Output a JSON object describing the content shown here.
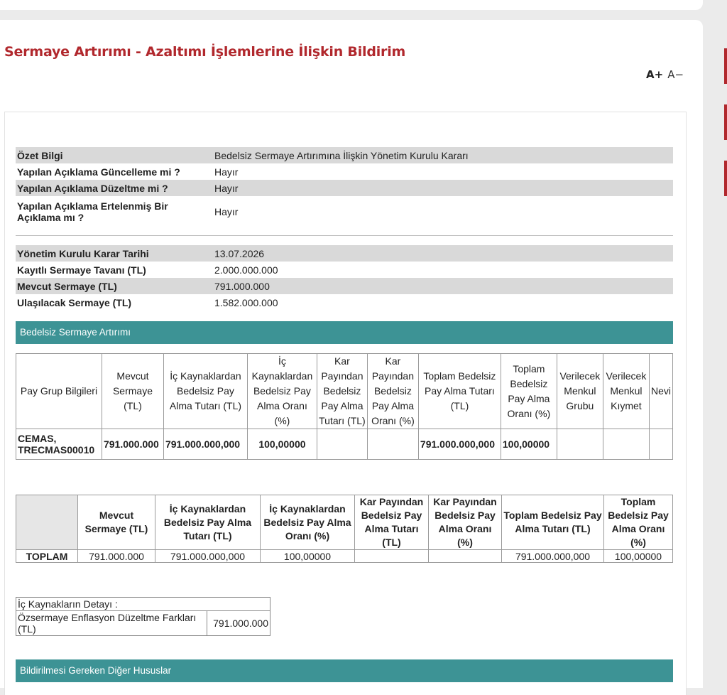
{
  "page_title": "Sermaye Artırımı - Azaltımı İşlemlerine İlişkin Bildirim",
  "font_controls": {
    "increase": "A+",
    "decrease": "A−"
  },
  "summary": [
    {
      "label": "Özet Bilgi",
      "value": "Bedelsiz Sermaye Artırımına İlişkin Yönetim Kurulu Kararı"
    },
    {
      "label": "Yapılan Açıklama Güncelleme mi ?",
      "value": "Hayır"
    },
    {
      "label": "Yapılan Açıklama Düzeltme mi ?",
      "value": "Hayır"
    },
    {
      "label": "Yapılan Açıklama Ertelenmiş Bir Açıklama mı ?",
      "value": "Hayır"
    }
  ],
  "capital": [
    {
      "label": "Yönetim Kurulu Karar Tarihi",
      "value": "13.07.2026"
    },
    {
      "label": "Kayıtlı Sermaye Tavanı (TL)",
      "value": "2.000.000.000"
    },
    {
      "label": "Mevcut Sermaye (TL)",
      "value": "791.000.000"
    },
    {
      "label": "Ulaşılacak Sermaye (TL)",
      "value": "1.582.000.000"
    }
  ],
  "section_bonus": "Bedelsiz Sermaye Artırımı",
  "pay_table": {
    "headers": [
      "Pay Grup Bilgileri",
      "Mevcut Sermaye (TL)",
      "İç Kaynaklardan Bedelsiz Pay Alma Tutarı (TL)",
      "İç Kaynaklardan Bedelsiz Pay Alma Oranı (%)",
      "Kar Payından Bedelsiz Pay Alma Tutarı (TL)",
      "Kar Payından Bedelsiz Pay Alma Oranı (%)",
      "Toplam Bedelsiz Pay Alma Tutarı (TL)",
      "Toplam Bedelsiz Pay Alma Oranı (%)",
      "Verilecek Menkul Grubu",
      "Verilecek Menkul Kıymet",
      "Nevi"
    ],
    "row": [
      "CEMAS, TRECMAS00010",
      "791.000.000",
      "791.000.000,000",
      "100,00000",
      "",
      "",
      "791.000.000,000",
      "100,00000",
      "",
      "",
      ""
    ]
  },
  "total_table": {
    "headers": [
      "",
      "Mevcut Sermaye (TL)",
      "İç Kaynaklardan Bedelsiz Pay Alma Tutarı (TL)",
      "İç Kaynaklardan Bedelsiz Pay Alma Oranı (%)",
      "Kar Payından Bedelsiz Pay Alma Tutarı (TL)",
      "Kar Payından Bedelsiz Pay Alma Oranı (%)",
      "Toplam Bedelsiz Pay Alma Tutarı (TL)",
      "Toplam Bedelsiz Pay Alma Oranı (%)"
    ],
    "row": [
      "TOPLAM",
      "791.000.000",
      "791.000.000,000",
      "100,00000",
      "",
      "",
      "791.000.000,000",
      "100,00000"
    ]
  },
  "internal_sources": {
    "title": "İç Kaynakların Detayı :",
    "label": "Özsermaye Enflasyon Düzeltme Farkları (TL)",
    "value": "791.000.000"
  },
  "section_other": "Bildirilmesi Gereken Diğer Hususlar"
}
